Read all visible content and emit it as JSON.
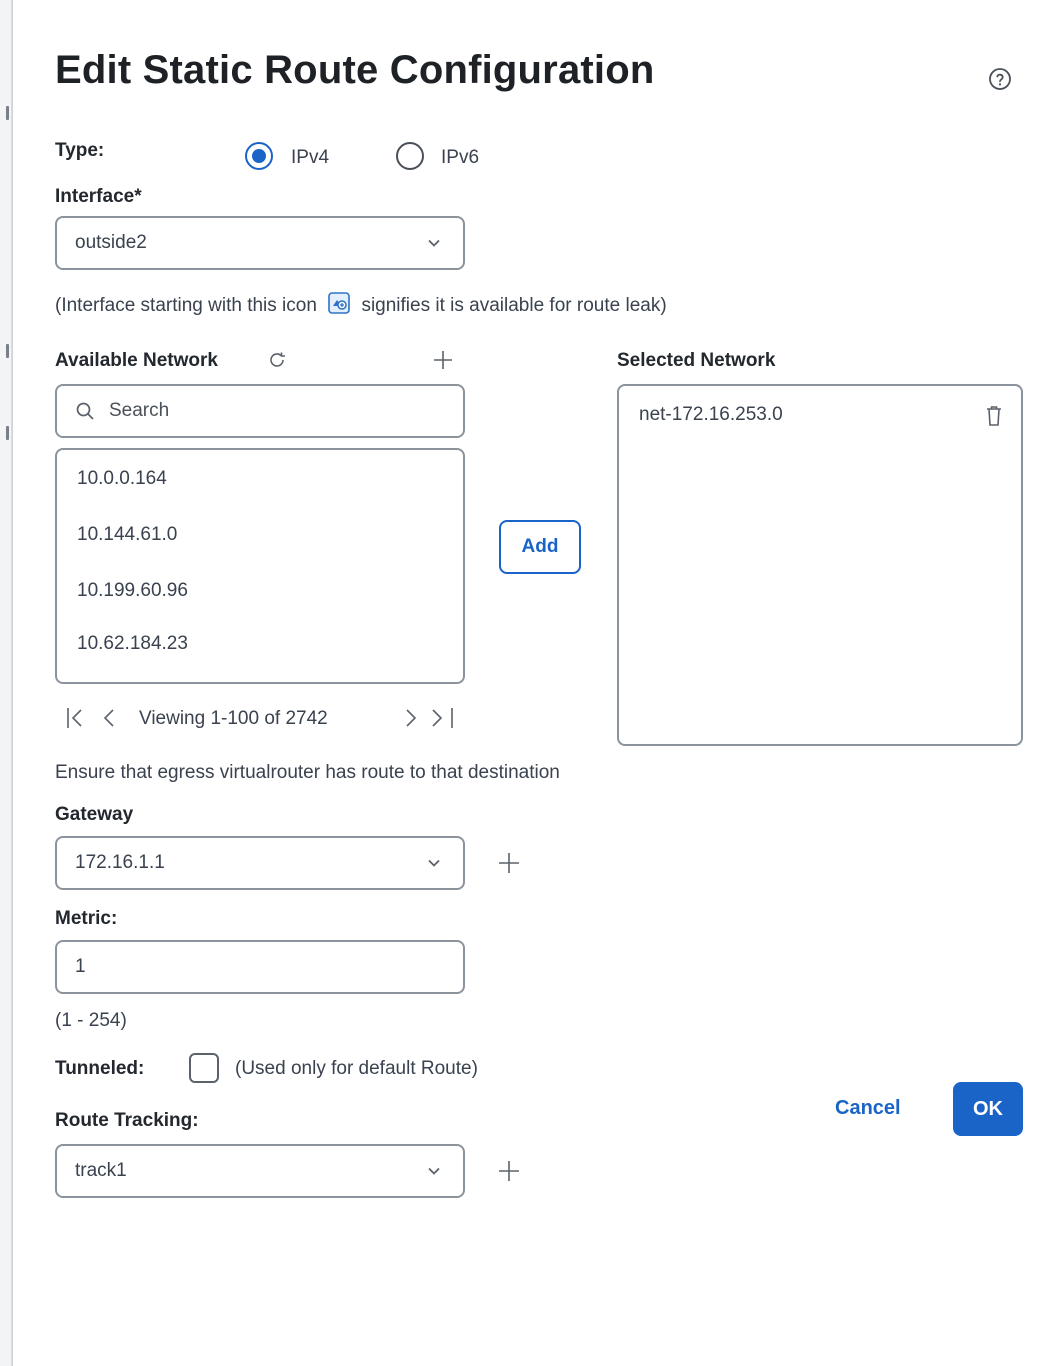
{
  "dialog": {
    "title": "Edit Static Route Configuration",
    "help_icon": "question-circle-icon"
  },
  "type": {
    "label": "Type:",
    "options": [
      {
        "label": "IPv4",
        "selected": true
      },
      {
        "label": "IPv6",
        "selected": false
      }
    ]
  },
  "interface": {
    "label": "Interface*",
    "value": "outside2",
    "note_before": "(Interface starting with this icon",
    "note_after": "signifies it is available for route leak)",
    "note_icon": "route-leak-icon"
  },
  "available_network": {
    "label": "Available Network",
    "search_placeholder": "Search",
    "items": [
      "10.0.0.164",
      "10.144.61.0",
      "10.199.60.96",
      "10.62.184.23"
    ],
    "pager_text": "Viewing 1-100 of 2742"
  },
  "add_button": "Add",
  "selected_network": {
    "label": "Selected Network",
    "items": [
      "net-172.16.253.0"
    ]
  },
  "egress_note": "Ensure that egress virtualrouter has route to that destination",
  "gateway": {
    "label": "Gateway",
    "value": "172.16.1.1"
  },
  "metric": {
    "label": "Metric:",
    "value": "1",
    "range": "(1 - 254)"
  },
  "tunneled": {
    "label": "Tunneled:",
    "note": "(Used only for default Route)",
    "checked": false
  },
  "route_tracking": {
    "label": "Route Tracking:",
    "value": "track1"
  },
  "footer": {
    "cancel": "Cancel",
    "ok": "OK"
  },
  "colors": {
    "accent": "#1a64c8",
    "border": "#8b939c",
    "text": "#23282e"
  }
}
